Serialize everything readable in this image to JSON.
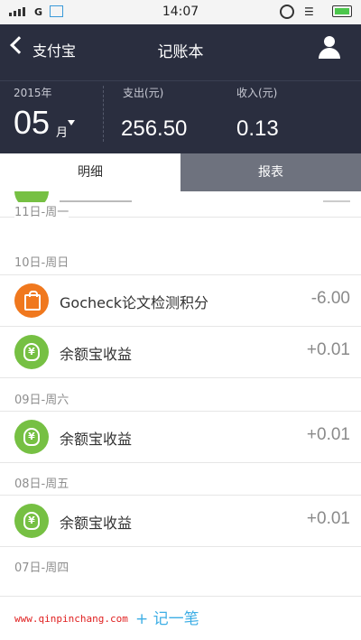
{
  "status_bar": {
    "network": "G",
    "time": "14:07"
  },
  "nav": {
    "back_label": "支付宝",
    "title": "记账本"
  },
  "summary": {
    "year": "2015年",
    "month": "05",
    "month_unit": "月",
    "expense_label": "支出(元)",
    "expense_value": "256.50",
    "income_label": "收入(元)",
    "income_value": "0.13"
  },
  "tabs": [
    {
      "label": "明细",
      "selected": true
    },
    {
      "label": "报表",
      "selected": false
    }
  ],
  "list": {
    "sections": [
      {
        "date": "11日-周一"
      },
      {
        "date": "10日-周日"
      },
      {
        "date": "09日-周六"
      },
      {
        "date": "08日-周五"
      },
      {
        "date": "07日-周四"
      }
    ],
    "rows": [
      {
        "title": "Gocheck论文检测积分",
        "amount": "-6.00",
        "icon": "shopping-bag-icon",
        "icon_color": "#f0781e"
      },
      {
        "title": "余额宝收益",
        "amount": "+0.01",
        "icon": "money-bag-icon",
        "icon_color": "#76c043"
      },
      {
        "title": "余额宝收益",
        "amount": "+0.01",
        "icon": "money-bag-icon",
        "icon_color": "#76c043"
      },
      {
        "title": "余额宝收益",
        "amount": "+0.01",
        "icon": "money-bag-icon",
        "icon_color": "#76c043"
      }
    ],
    "yen_symbol": "¥"
  },
  "bottom": {
    "add_label": "+ 记一笔",
    "watermark": "www.qinpinchang.com"
  },
  "colors": {
    "header_bg": "#2a2e3f",
    "accent": "#3eaee5",
    "green": "#76c043",
    "orange": "#f0781e"
  }
}
